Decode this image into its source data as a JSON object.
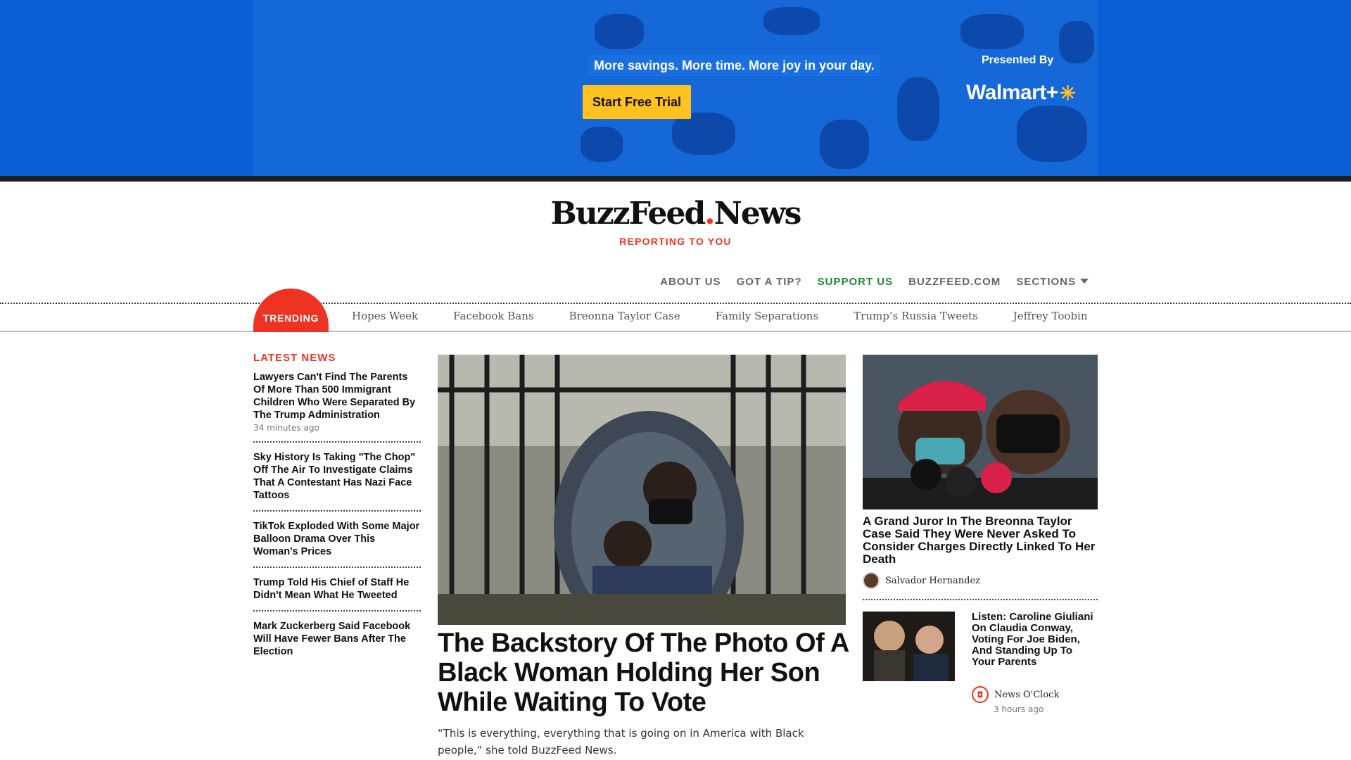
{
  "ad": {
    "tagline": "More savings. More time. More joy in your day.",
    "cta": "Start Free Trial",
    "presented_by": "Presented By",
    "brand": "Walmart+",
    "colors": {
      "background": "#0b5fd6",
      "cta": "#ffc220"
    }
  },
  "masthead": {
    "logo_left": "BuzzFeed",
    "logo_dot": ".",
    "logo_right": "News",
    "tagline": "REPORTING TO YOU"
  },
  "topnav": {
    "about": "ABOUT US",
    "tip": "GOT A TIP?",
    "support": "SUPPORT US",
    "buzzfeed": "BUZZFEED.COM",
    "sections": "SECTIONS"
  },
  "trending": {
    "label": "TRENDING",
    "links": [
      "Hopes Week",
      "Facebook Bans",
      "Breonna Taylor Case",
      "Family Separations",
      "Trump’s Russia Tweets",
      "Jeffrey Toobin"
    ]
  },
  "latest": {
    "heading": "LATEST NEWS",
    "items": [
      {
        "title": "Lawyers Can't Find The Parents Of More Than 500 Immigrant Children Who Were Separated By The Trump Administration",
        "time": "34 minutes ago"
      },
      {
        "title": "Sky History Is Taking \"The Chop\" Off The Air To Investigate Claims That A Contestant Has Nazi Face Tattoos"
      },
      {
        "title": "TikTok Exploded With Some Major Balloon Drama Over This Woman's Prices"
      },
      {
        "title": "Trump Told His Chief of Staff He Didn't Mean What He Tweeted"
      },
      {
        "title": "Mark Zuckerberg Said Facebook Will Have Fewer Bans After The Election"
      }
    ]
  },
  "hero": {
    "title": "The Backstory Of The Photo Of A Black Woman Holding Her Son While Waiting To Vote",
    "dek": "“This is everything, everything that is going on in America with Black people,” she told BuzzFeed News."
  },
  "right_top": {
    "title": "A Grand Juror In The Breonna Taylor Case Said They Were Never Asked To Consider Charges Directly Linked To Her Death",
    "author": "Salvador Hernandez"
  },
  "right_small": {
    "title": "Listen: Caroline Giuliani On Claudia Conway, Voting For Joe Biden, And Standing Up To Your Parents",
    "source": "News O'Clock",
    "time": "3 hours ago"
  }
}
